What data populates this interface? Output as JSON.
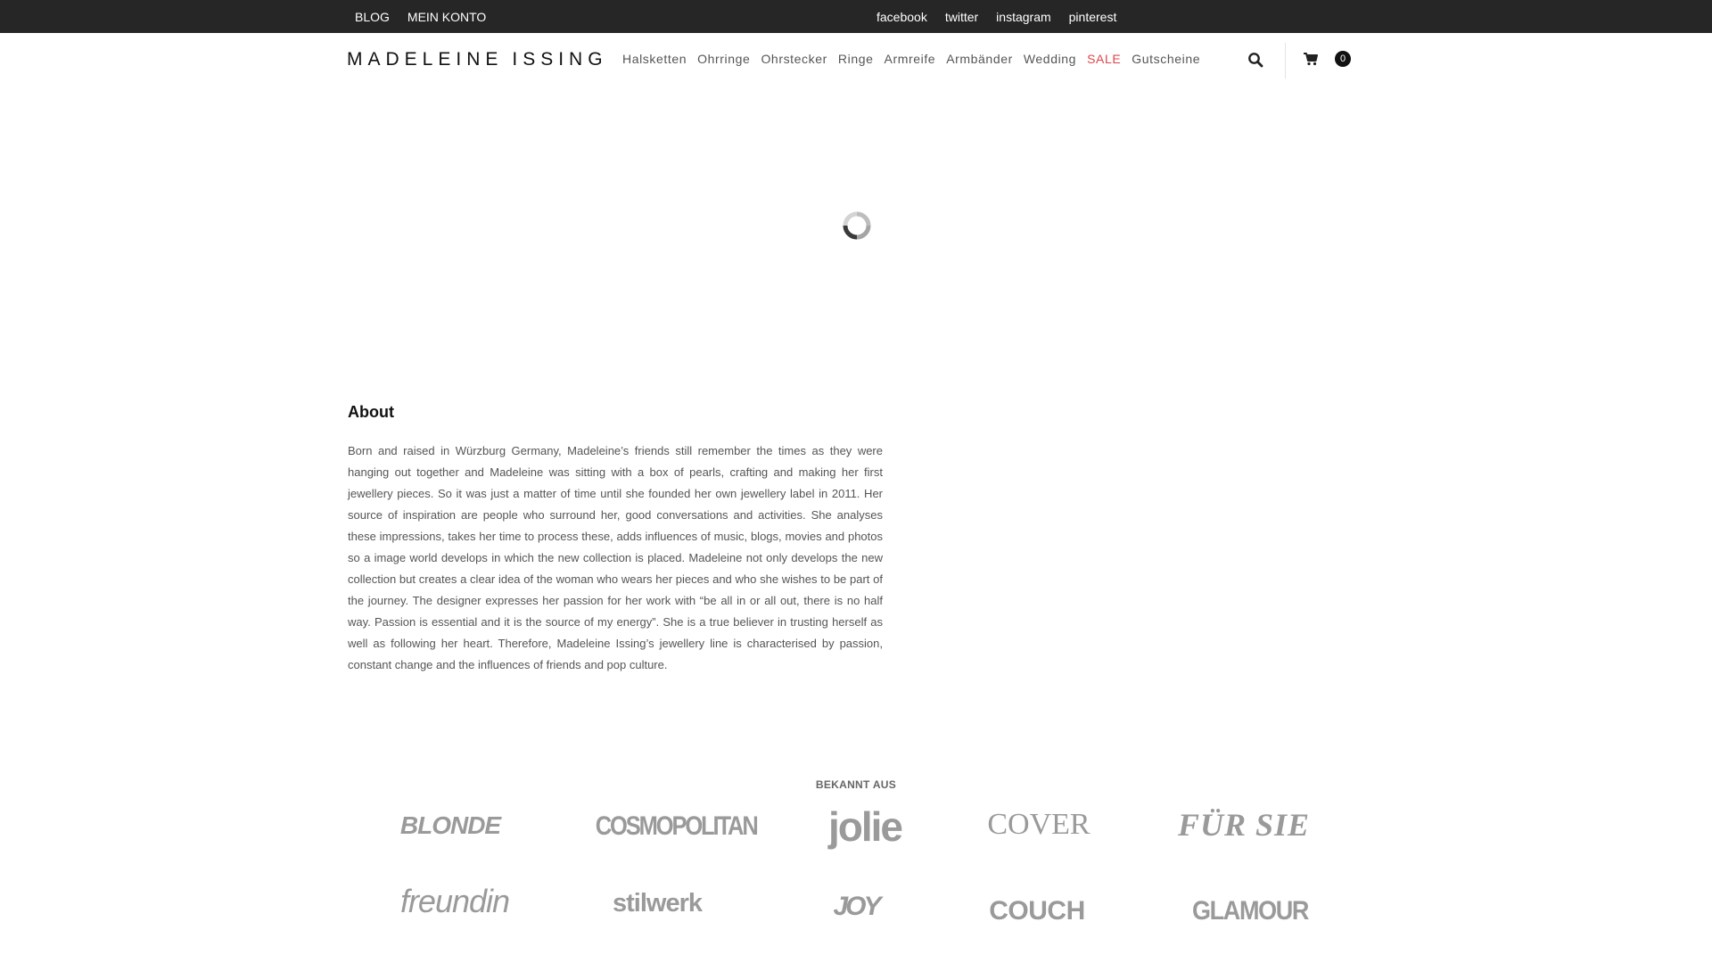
{
  "topbar": {
    "left_links": [
      "BLOG",
      "MEIN KONTO"
    ],
    "social_links": [
      "facebook",
      "twitter",
      "instagram",
      "pinterest"
    ]
  },
  "header": {
    "logo_text": "MADELEINE ISSING",
    "logo_words": [
      "MADELEINE",
      "ISSING"
    ],
    "nav_items": [
      "Halsketten",
      "Ohrringe",
      "Ohrstecker",
      "Ringe",
      "Armreife",
      "Armbänder",
      "Wedding",
      "SALE",
      "Gutscheine"
    ],
    "sale_color": "#e0464a",
    "search_icon": "search-icon",
    "cart_icon": "cart-icon",
    "cart_count": "0"
  },
  "loader": {
    "icon": "loading-spinner-icon"
  },
  "about": {
    "title": "About",
    "text": "Born and raised in Würzburg Germany, Madeleine’s friends still remember the times as they were hanging out together and Madeleine was sitting with a box of pearls, crafting and making her first jewellery pieces. So it was just a matter of time until she founded her own jewellery label in 2011. Her source of inspiration are people who surround her, good conversations and activities. She analyses these impressions, takes her time to process these, adds influences of music, blogs, movies and photos so a image world develops in which the new collection is placed. Madeleine not only develops the new collection but creates a clear idea of the woman who wears her pieces and who she wishes to be part of the journey. The designer expresses her passion for her work with “be all in or all out, there is no half way. Passion is essential and it is the source of my energy”. She is a true believer in trusting herself as well as following her heart. Therefore, Madeleine Issing’s jewellery line is characterised by passion, constant change and the influences of friends and pop culture."
  },
  "press": {
    "heading": "BEKANNT AUS",
    "logos": [
      "BLONDE",
      "COSMOPOLITAN",
      "jolie",
      "COVER",
      "FÜR SIE",
      "freundin",
      "stilwerk",
      "JOY",
      "COUCH",
      "GLAMOUR"
    ]
  }
}
